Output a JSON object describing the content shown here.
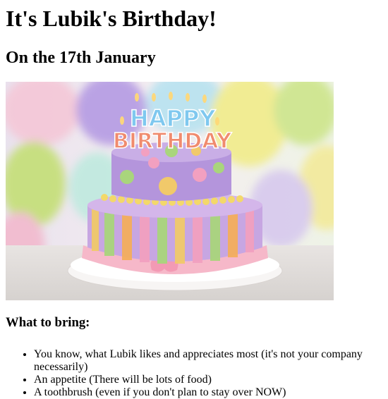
{
  "page": {
    "title": "It's Lubik's Birthday!",
    "subtitle": "On the 17th January",
    "image": {
      "alt": "Birthday cake with candles spelling HAPPY BIRTHDAY in front of balloons",
      "candle_line_1": "HAPPY",
      "candle_line_2": "BIRTHDAY"
    },
    "bring_heading": "What to bring:",
    "bring_items": [
      "You know, what Lubik likes and appreciates most (it's not your company necessarily)",
      "An appetite (There will be lots of food)",
      "A toothbrush (even if you don't plan to stay over NOW)"
    ]
  }
}
